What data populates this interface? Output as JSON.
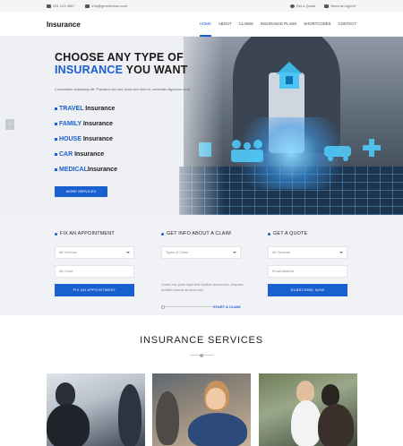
{
  "topbar": {
    "phone": "251 123 4567",
    "email": "info@greenfuture.com",
    "quote_link": "Get a Quote",
    "agent_link": "Need an Agent?"
  },
  "header": {
    "logo": "Insurance",
    "nav": [
      "HOME",
      "ABOUT",
      "CLAIMS",
      "INSURANCE PLANS",
      "SHORTCODES",
      "CONTACT"
    ]
  },
  "hero": {
    "title_line1": "CHOOSE ANY TYPE OF",
    "title_blue": "INSURANCE",
    "title_rest": " YOU WANT",
    "lead": "Consectetur adipiscing elit. Praesent orci nisl, porta sed diam id, venenatis dignissim urna.",
    "types": [
      {
        "bold": "TRAVEL",
        "rest": " Insurance"
      },
      {
        "bold": "FAMILY",
        "rest": " Insurance"
      },
      {
        "bold": "HOUSE",
        "rest": " Insurance"
      },
      {
        "bold": "CAR",
        "rest": " Insurance"
      },
      {
        "bold": "MEDICAL",
        "rest": "Insurance"
      }
    ],
    "more_button": "MORE SERVICES",
    "slider_prev": "‹"
  },
  "appointment": {
    "title": "FIX AN APPOINTMENT",
    "select": "All Services",
    "zip_placeholder": "Zip Code",
    "button": "FIX AN APPOINTMENT"
  },
  "claim": {
    "title": "GET INFO ABOUT A CLAIM",
    "select": "Types of Claim",
    "text": "Donec nec justo eget felis facilisis fermentum. Aliquam porttitor mauris sit amet orci.",
    "link": "START A CLAIM"
  },
  "quote": {
    "title": "GET A QUOTE",
    "select": "All Services",
    "email_placeholder": "Email Address",
    "button": "SUBSCRIBE NOW"
  },
  "services": {
    "title": "INSURANCE SERVICES"
  },
  "colors": {
    "accent": "#1a5fd0",
    "forms_bg": "#f1f2f5"
  }
}
